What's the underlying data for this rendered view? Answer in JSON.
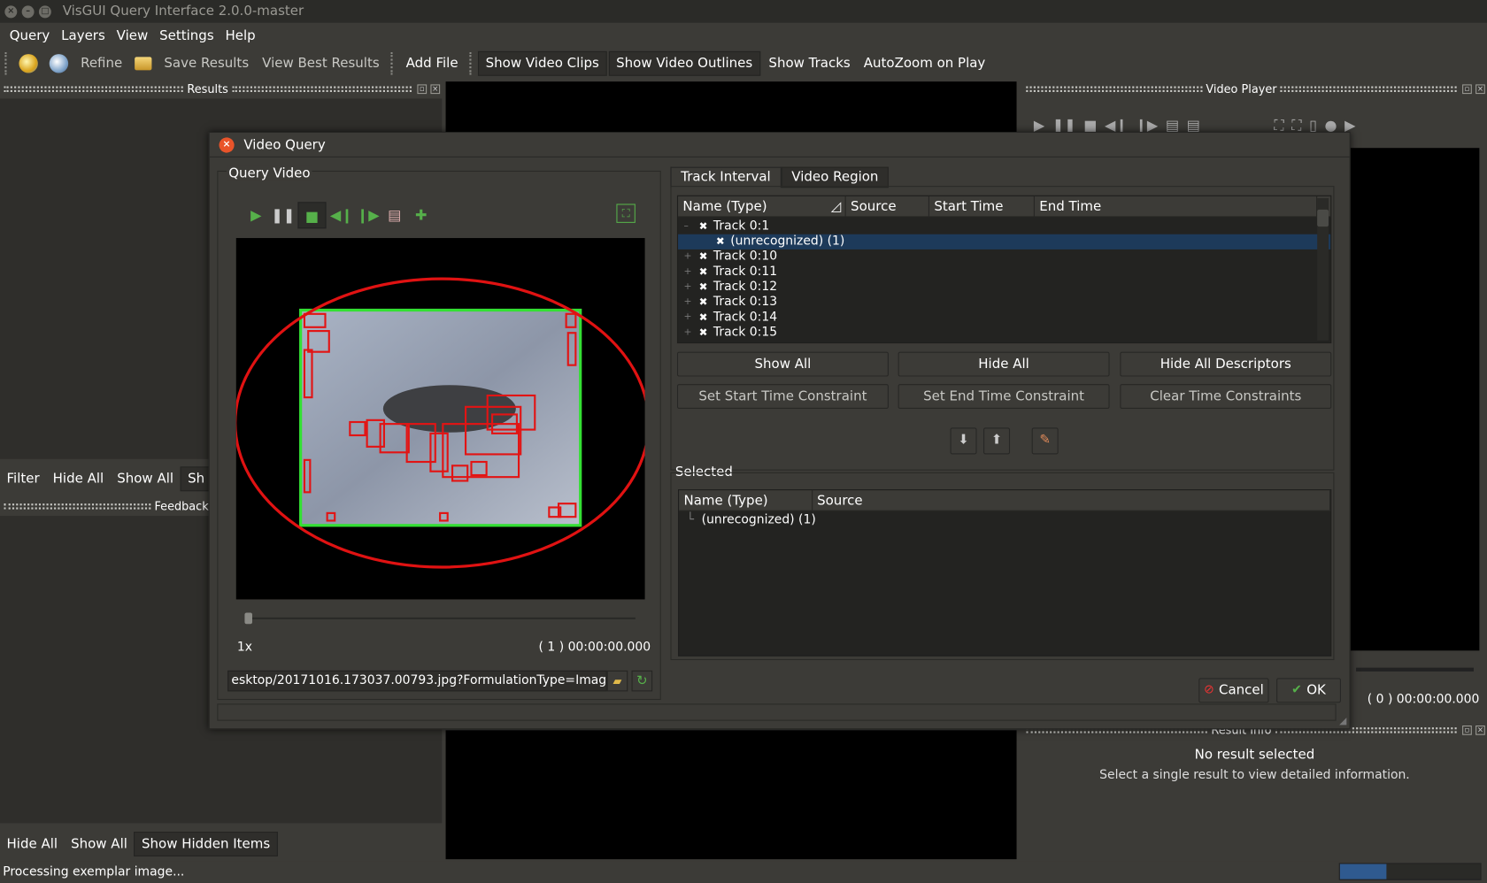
{
  "window": {
    "title": "VisGUI Query Interface 2.0.0-master"
  },
  "menu": [
    "Query",
    "Layers",
    "View",
    "Settings",
    "Help"
  ],
  "toolbar": {
    "refine": "Refine",
    "save_results": "Save Results",
    "view_best": "View Best Results",
    "add_file": "Add File",
    "show_video_clips": "Show Video Clips",
    "show_video_outlines": "Show Video Outlines",
    "show_tracks": "Show Tracks",
    "autozoom": "AutoZoom on Play"
  },
  "docks": {
    "results": "Results",
    "video_player": "Video Player",
    "feedback": "Feedback",
    "result_info": "Result Info"
  },
  "filterbar": {
    "filter": "Filter",
    "hide_all": "Hide All",
    "show_all": "Show All",
    "partial": "Sh"
  },
  "bottombar": {
    "hide_all": "Hide All",
    "show_all": "Show All",
    "show_hidden": "Show Hidden Items"
  },
  "player": {
    "time": "( 0 )  00:00:00.000"
  },
  "result_info": {
    "title": "No result selected",
    "subtitle": "Select a single result to view detailed information."
  },
  "status": {
    "text": "Processing exemplar image...",
    "progress": 0.33
  },
  "dialog": {
    "title": "Video Query",
    "query_video_label": "Query Video",
    "speed": "1x",
    "time": "( 1 )  00:00:00.000",
    "file_path": "esktop/20171016.173037.00793.jpg?FormulationType=Image",
    "tabs": [
      "Track Interval",
      "Video Region"
    ],
    "columns": [
      "Name (Type)",
      "Source",
      "Start Time",
      "End Time"
    ],
    "tracks": [
      {
        "label": "Track 0:1",
        "expanded": true
      },
      {
        "label": "(unrecognized) (1)",
        "child": true,
        "selected": true
      },
      {
        "label": "Track 0:10"
      },
      {
        "label": "Track 0:11"
      },
      {
        "label": "Track 0:12"
      },
      {
        "label": "Track 0:13"
      },
      {
        "label": "Track 0:14"
      },
      {
        "label": "Track 0:15"
      }
    ],
    "buttons": {
      "show_all": "Show All",
      "hide_all": "Hide All",
      "hide_descriptors": "Hide All Descriptors",
      "set_start": "Set Start Time Constraint",
      "set_end": "Set End Time Constraint",
      "clear_time": "Clear Time Constraints",
      "cancel": "Cancel",
      "ok": "OK"
    },
    "selected_label": "Selected",
    "selected_columns": [
      "Name (Type)",
      "Source"
    ],
    "selected_items": [
      "(unrecognized) (1)"
    ]
  }
}
